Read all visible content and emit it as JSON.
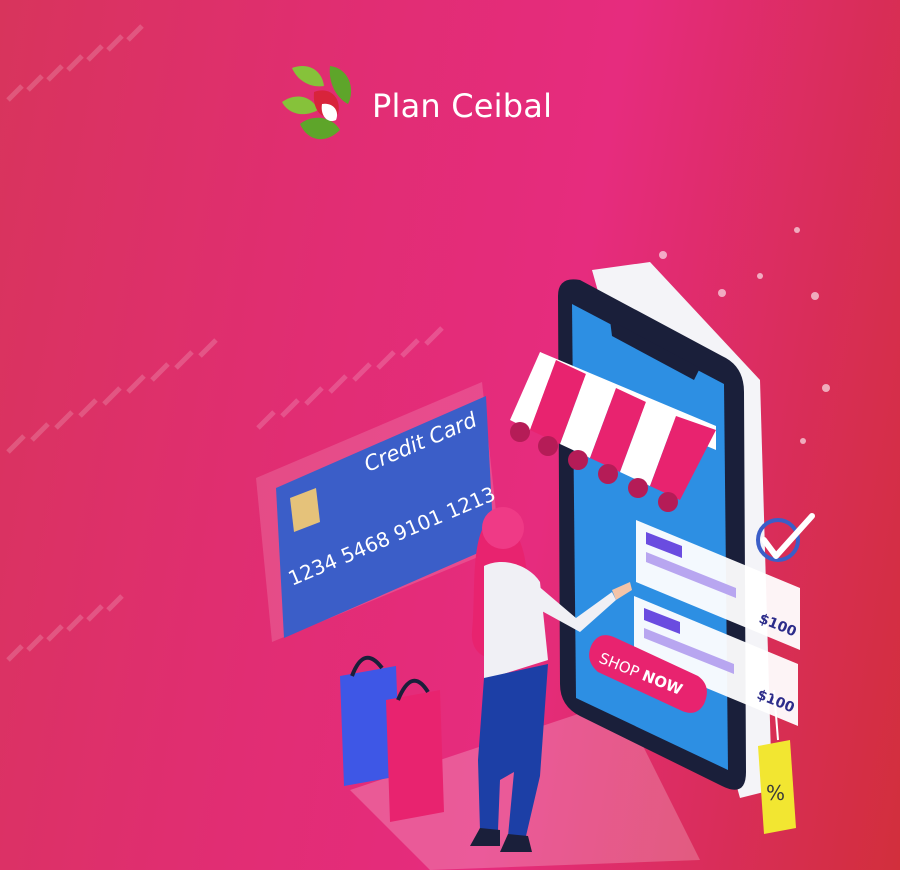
{
  "brand": {
    "name": "Plan Ceibal",
    "logo_icon": "ceibal-flower-logo-icon"
  },
  "card": {
    "label": "Credit Card",
    "number": "1234 5468 9101 1213"
  },
  "shop": {
    "cta": "SHOP",
    "cta_bold": "NOW"
  },
  "products": [
    {
      "price": "$100"
    },
    {
      "price": "$100"
    }
  ],
  "tag": {
    "symbol": "%"
  },
  "colors": {
    "accent": "#e8236f",
    "card": "#3b5ec8",
    "screen": "#2d8fe3",
    "tag": "#f2e631"
  }
}
